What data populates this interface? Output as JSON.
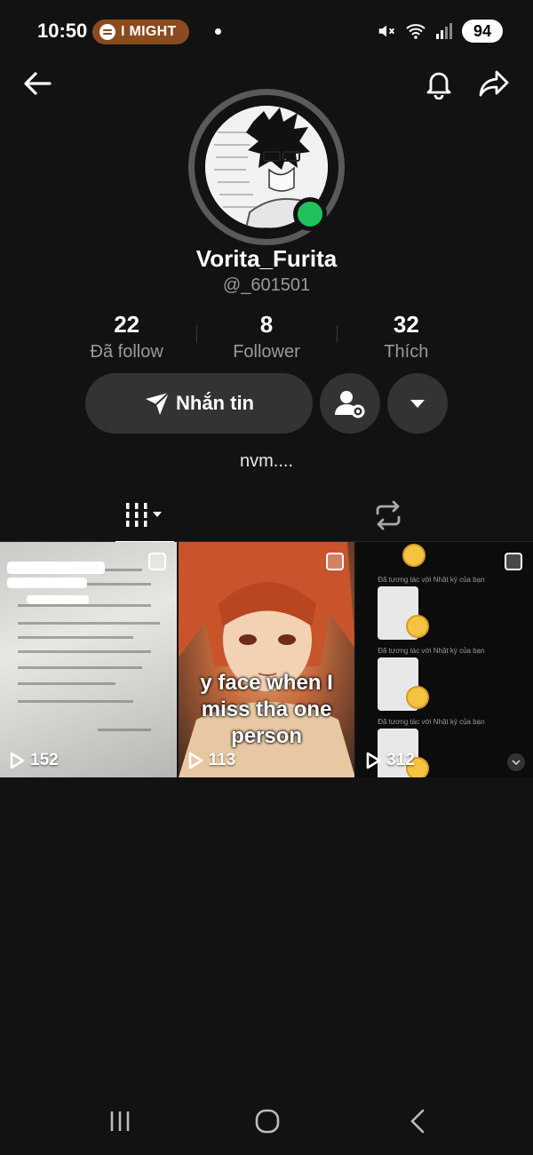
{
  "status_bar": {
    "time": "10:50",
    "now_playing": "I MIGHT",
    "battery": "94"
  },
  "profile": {
    "display_name": "Vorita_Furita",
    "username": "@_601501",
    "bio": "nvm....",
    "stats": [
      {
        "value": "22",
        "label": "Đã follow"
      },
      {
        "value": "8",
        "label": "Follower"
      },
      {
        "value": "32",
        "label": "Thích"
      }
    ],
    "message_button": "Nhắn tin"
  },
  "videos": [
    {
      "views": "152",
      "caption": ""
    },
    {
      "views": "113",
      "caption": "y face when I miss tha one person"
    },
    {
      "views": "312",
      "caption": ""
    }
  ],
  "story_tile": {
    "interaction_text": "Đã tương tác với Nhật ký của bạn"
  },
  "colors": {
    "background": "#121212",
    "button": "#333333",
    "online": "#1fc15a",
    "muted_text": "#9a9a9a"
  },
  "icons": [
    "back-arrow-icon",
    "bell-icon",
    "share-icon",
    "send-icon",
    "user-settings-icon",
    "caret-down-icon",
    "grid-icon",
    "repost-icon",
    "play-icon",
    "recents-icon",
    "home-icon",
    "back-icon"
  ]
}
